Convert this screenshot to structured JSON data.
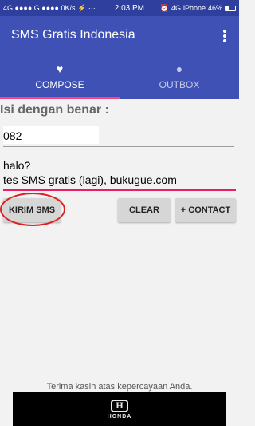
{
  "status_bar": {
    "left": "4G ●●●● G ●●●● 0K/s ⚡ ···",
    "time": "2:03 PM",
    "network": "4G",
    "carrier": "iPhone",
    "battery": "46%",
    "battery_level": 0.46
  },
  "app": {
    "title": "SMS Gratis Indonesia"
  },
  "tabs": [
    {
      "label": "COMPOSE",
      "icon": "heart-icon",
      "selected": true
    },
    {
      "label": "OUTBOX",
      "icon": "person-icon",
      "selected": false
    }
  ],
  "form": {
    "label": "Isi dengan benar :",
    "phone_value": "082",
    "message_line1": "halo?",
    "message_line2": "tes SMS gratis (lagi), bukugue.com"
  },
  "buttons": {
    "send": "KIRIM SMS",
    "clear": "CLEAR",
    "contact": "+ CONTACT"
  },
  "footer": {
    "text": "Terima kasih atas kepercayaan Anda.",
    "ad_brand": "HONDA"
  },
  "colors": {
    "primary": "#3f51b5",
    "accent": "#e91e63",
    "highlight_circle": "#e02020"
  }
}
